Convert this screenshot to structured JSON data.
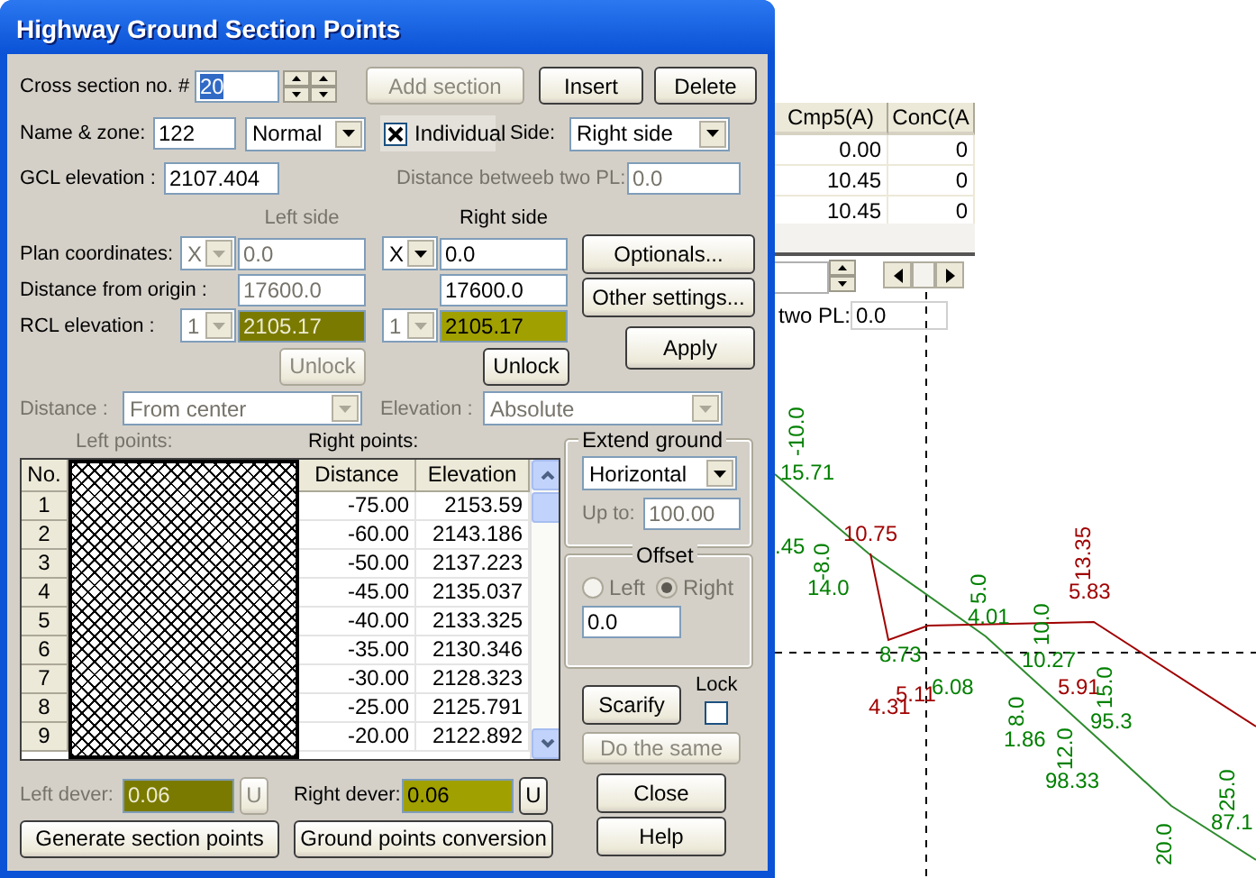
{
  "window": {
    "title": "Highway Ground Section Points"
  },
  "cross_section": {
    "label": "Cross section no. #",
    "value": "20"
  },
  "top_buttons": [
    {
      "label": "Add section",
      "disabled": true
    },
    {
      "label": "Insert",
      "disabled": false
    },
    {
      "label": "Delete",
      "disabled": false
    }
  ],
  "name_zone": {
    "label": "Name & zone:",
    "value": "122",
    "zone": "Normal"
  },
  "individual": {
    "label": "Individual",
    "checked": true
  },
  "side": {
    "label": "Side:",
    "value": "Right side"
  },
  "gcl": {
    "label": "GCL elevation :",
    "value": "2107.404"
  },
  "distance_pl": {
    "label": "Distance betweeb two PL:",
    "value": "0.0",
    "disabled": true
  },
  "row_labels": {
    "plan": "Plan coordinates:",
    "origin": "Distance from origin :",
    "rcl": "RCL elevation :"
  },
  "sides": [
    {
      "heading": "Left side",
      "disabled": true,
      "axis": "X",
      "plan": "0.0",
      "origin": "17600.0",
      "rcl_index": "1",
      "index_disabled": true,
      "rcl": "2105.17",
      "unlock": "Unlock"
    },
    {
      "heading": "Right side",
      "disabled": false,
      "axis": "X",
      "plan": "0.0",
      "origin": "17600.0",
      "rcl_index": "1",
      "index_disabled": true,
      "rcl": "2105.17",
      "unlock": "Unlock"
    }
  ],
  "settings_buttons": [
    "Optionals...",
    "Other settings...",
    "Apply"
  ],
  "distance_mode": {
    "label": "Distance :",
    "value": "From center",
    "disabled": true
  },
  "elevation_mode": {
    "label": "Elevation :",
    "value": "Absolute",
    "disabled": true
  },
  "points": {
    "left_label": "Left points:",
    "left_disabled": true,
    "right_label": "Right points:",
    "columns": [
      "No.",
      "Distance",
      "Elevation"
    ],
    "rows": [
      {
        "no": "1",
        "distance": "-75.00",
        "elevation": "2153.59"
      },
      {
        "no": "2",
        "distance": "-60.00",
        "elevation": "2143.186"
      },
      {
        "no": "3",
        "distance": "-50.00",
        "elevation": "2137.223"
      },
      {
        "no": "4",
        "distance": "-45.00",
        "elevation": "2135.037"
      },
      {
        "no": "5",
        "distance": "-40.00",
        "elevation": "2133.325"
      },
      {
        "no": "6",
        "distance": "-35.00",
        "elevation": "2130.346"
      },
      {
        "no": "7",
        "distance": "-30.00",
        "elevation": "2128.323"
      },
      {
        "no": "8",
        "distance": "-25.00",
        "elevation": "2125.791"
      },
      {
        "no": "9",
        "distance": "-20.00",
        "elevation": "2122.892"
      }
    ]
  },
  "extend_ground": {
    "title": "Extend ground",
    "value": "Horizontal",
    "up_to_label": "Up to:",
    "up_to": "100.00",
    "up_to_disabled": true
  },
  "offset": {
    "title": "Offset",
    "disabled": true,
    "options": [
      {
        "label": "Left",
        "selected": false
      },
      {
        "label": "Right",
        "selected": true
      }
    ],
    "value": "0.0"
  },
  "scarify": {
    "label": "Scarify"
  },
  "lock": {
    "label": "Lock",
    "checked": false
  },
  "do_same": {
    "label": "Do the same",
    "disabled": true
  },
  "devers": [
    {
      "label": "Left dever:",
      "value": "0.06",
      "button": "U",
      "disabled": true
    },
    {
      "label": "Right dever:",
      "value": "0.06",
      "button": "U",
      "disabled": false
    }
  ],
  "bottom_buttons": [
    "Generate section points",
    "Ground points conversion"
  ],
  "dialog_buttons": [
    "Close",
    "Help"
  ],
  "background": {
    "table": {
      "columns": [
        "Cmp5(A)",
        "ConC(A"
      ],
      "rows": [
        [
          "0.00",
          "0"
        ],
        [
          "10.45",
          "0"
        ],
        [
          "10.45",
          "0"
        ]
      ]
    },
    "pl_label": "two PL:",
    "pl_value": "0.0",
    "drawing_labels": [
      {
        "text": "-10.0",
        "color": "#008000",
        "vertical": true
      },
      {
        "text": "15.71",
        "color": "#008000",
        "vertical": false
      },
      {
        "text": ".45",
        "color": "#008000",
        "vertical": false
      },
      {
        "text": "-8.0",
        "color": "#008000",
        "vertical": true
      },
      {
        "text": "14.0",
        "color": "#008000",
        "vertical": false
      },
      {
        "text": "10.75",
        "color": "#a00000",
        "vertical": false
      },
      {
        "text": "5.0",
        "color": "#008000",
        "vertical": true
      },
      {
        "text": "4.01",
        "color": "#008000",
        "vertical": false
      },
      {
        "text": "13.35",
        "color": "#a00000",
        "vertical": true
      },
      {
        "text": "5.83",
        "color": "#a00000",
        "vertical": false
      },
      {
        "text": "10.0",
        "color": "#008000",
        "vertical": true
      },
      {
        "text": "10.27",
        "color": "#008000",
        "vertical": false
      },
      {
        "text": "5.91",
        "color": "#a00000",
        "vertical": false
      },
      {
        "text": "15.0",
        "color": "#008000",
        "vertical": true
      },
      {
        "text": "95.3",
        "color": "#008000",
        "vertical": false
      },
      {
        "text": "8.0",
        "color": "#008000",
        "vertical": true
      },
      {
        "text": "1.86",
        "color": "#008000",
        "vertical": false
      },
      {
        "text": "12.0",
        "color": "#008000",
        "vertical": true
      },
      {
        "text": "98.33",
        "color": "#008000",
        "vertical": false
      },
      {
        "text": "6.08",
        "color": "#008000",
        "vertical": false
      },
      {
        "text": "8.73",
        "color": "#008000",
        "vertical": false
      },
      {
        "text": "4.31",
        "color": "#a00000",
        "vertical": false
      },
      {
        "text": "5.11",
        "color": "#a00000",
        "vertical": false
      },
      {
        "text": "25.0",
        "color": "#008000",
        "vertical": true
      },
      {
        "text": "87.1",
        "color": "#008000",
        "vertical": false
      },
      {
        "text": "20.0",
        "color": "#008000",
        "vertical": true
      }
    ]
  }
}
